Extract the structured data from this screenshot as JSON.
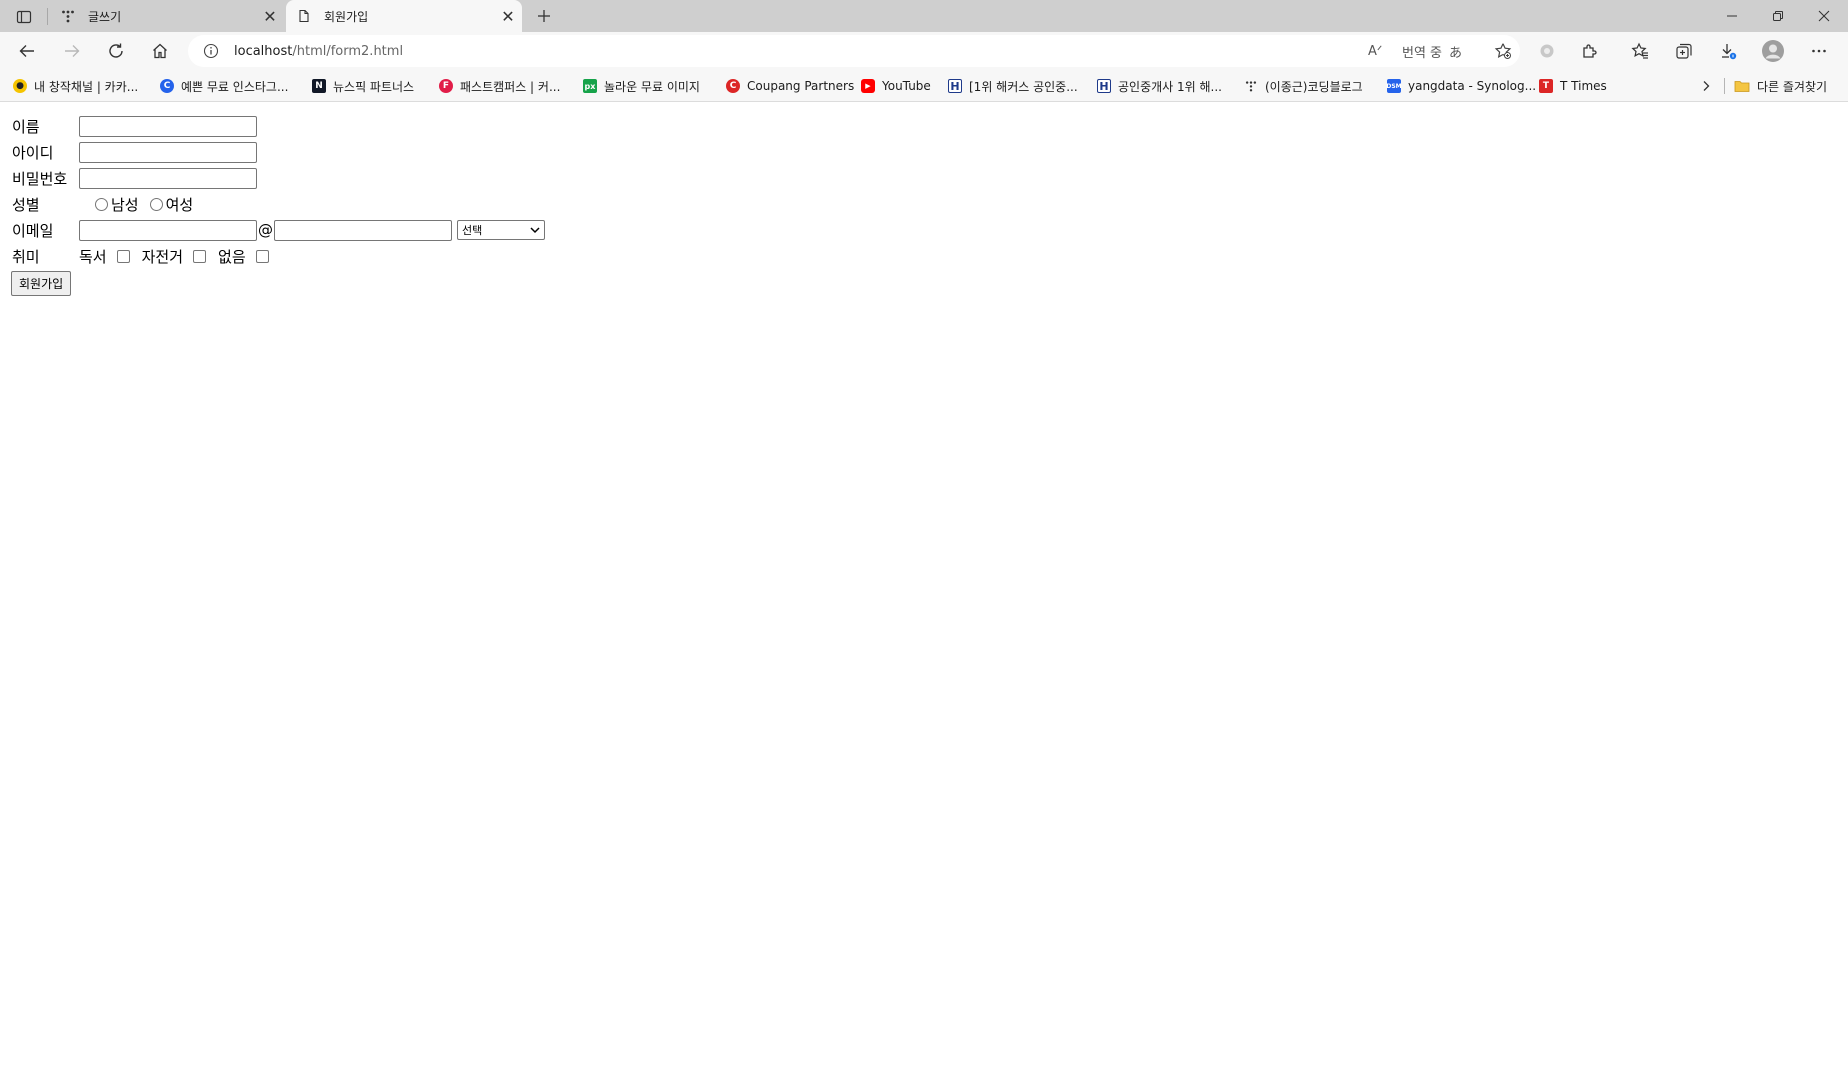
{
  "browser": {
    "tabs": [
      {
        "title": "글쓰기",
        "icon": "kakao-tistory-icon",
        "active": false
      },
      {
        "title": "회원가입",
        "icon": "page-icon",
        "active": true
      }
    ],
    "address": {
      "host": "localhost",
      "path": "/html/form2.html",
      "status_text": "번역 중",
      "read_aloud_label": "Aᐟ",
      "translate_glyph": "あ"
    },
    "bookmarks": [
      {
        "label": "내 창작채널 | 카카...",
        "icon": "kakao-channel-icon",
        "color": "#f5c400"
      },
      {
        "label": "예쁜 무료 인스타그...",
        "icon": "canva-icon",
        "color": "#2563eb"
      },
      {
        "label": "뉴스픽 파트너스",
        "icon": "newspick-icon",
        "color": "#111827"
      },
      {
        "label": "패스트캠퍼스 | 커...",
        "icon": "fastcampus-icon",
        "color": "#e11d48"
      },
      {
        "label": "놀라운 무료 이미지",
        "icon": "pixabay-icon",
        "color": "#16a34a"
      },
      {
        "label": "Coupang Partners",
        "icon": "coupang-icon",
        "color": "#dc2626"
      },
      {
        "label": "YouTube",
        "icon": "youtube-icon",
        "color": "#ff0000"
      },
      {
        "label": "[1위 해커스 공인중...",
        "icon": "hackers-icon",
        "color": "#1e3a8a"
      },
      {
        "label": "공인중개사 1위 해...",
        "icon": "hackers-icon",
        "color": "#1e3a8a"
      },
      {
        "label": "(이종근)코딩블로그",
        "icon": "tistory-icon",
        "color": "#333333"
      },
      {
        "label": "yangdata - Synolog...",
        "icon": "synology-icon",
        "color": "#2563eb"
      },
      {
        "label": "T Times",
        "icon": "ttimes-icon",
        "color": "#dc2626"
      }
    ],
    "other_favorites": "다른 즐겨찾기"
  },
  "form": {
    "name_label": "이름",
    "id_label": "아이디",
    "password_label": "비밀번호",
    "gender_label": "성별",
    "gender_options": [
      "남성",
      "여성"
    ],
    "email_label": "이메일",
    "email_at": "@",
    "email_domain_select": "선택",
    "hobby_label": "취미",
    "hobbies": [
      "독서",
      "자전거",
      "없음"
    ],
    "submit_label": "회원가입"
  }
}
